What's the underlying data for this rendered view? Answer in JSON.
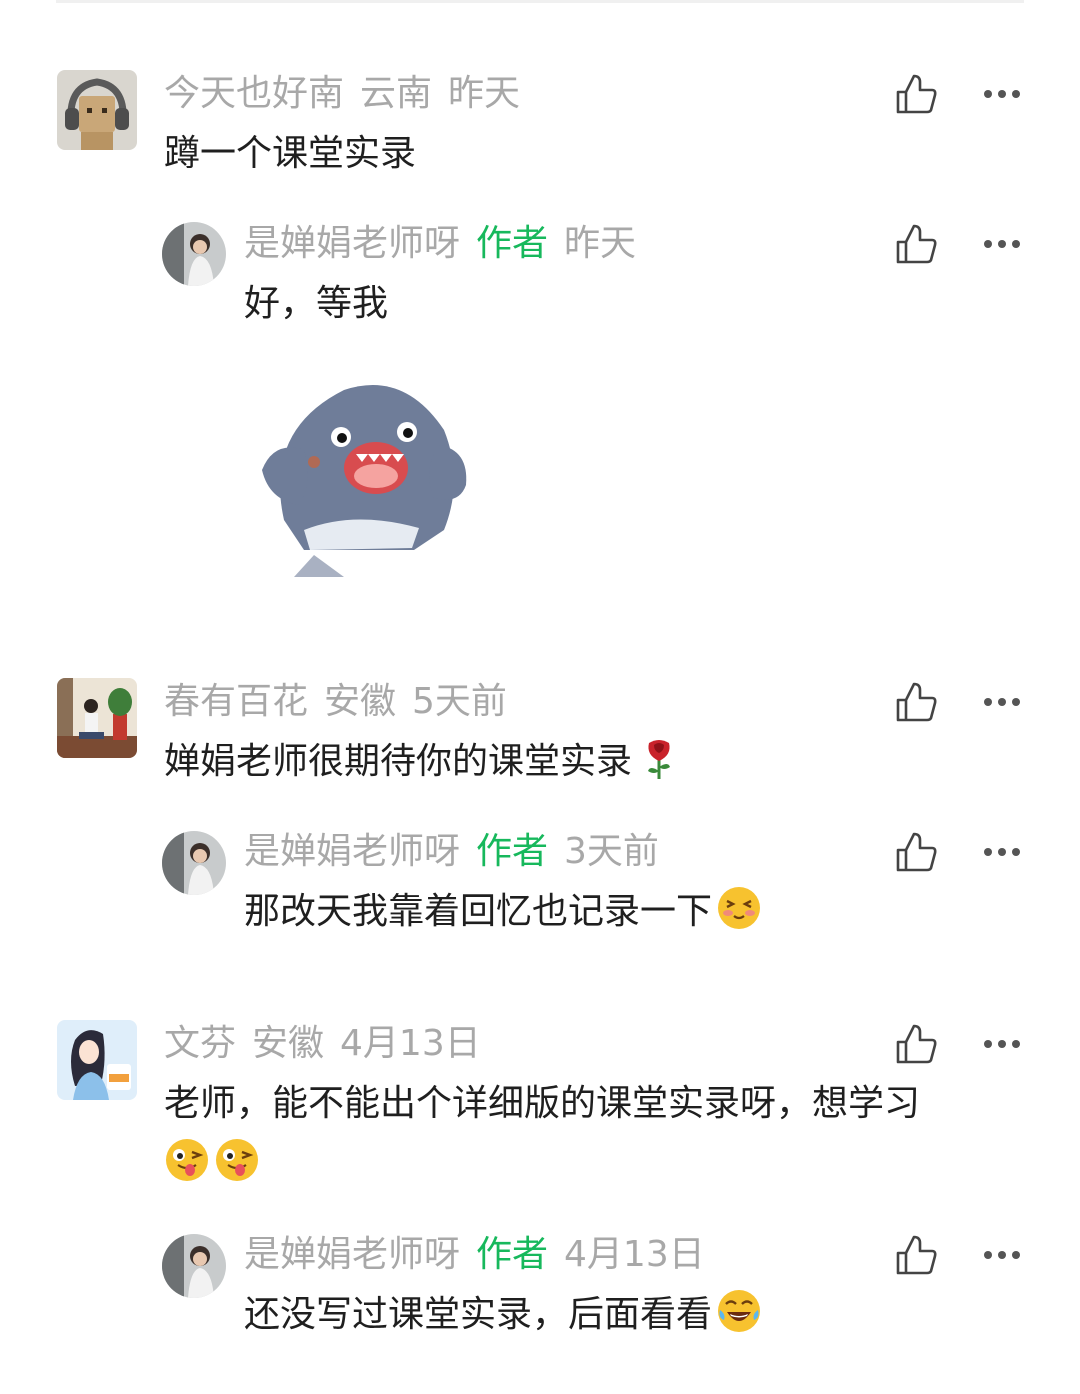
{
  "comments": [
    {
      "name": "今天也好南",
      "location": "云南",
      "time": "昨天",
      "text": "蹲一个课堂实录",
      "reply": {
        "name": "是婵娟老师呀",
        "tag": "作者",
        "time": "昨天",
        "text": "好，等我"
      }
    },
    {
      "name": "春有百花",
      "location": "安徽",
      "time": "5天前",
      "text": "婵娟老师很期待你的课堂实录",
      "text_emoji": "rose-icon",
      "reply": {
        "name": "是婵娟老师呀",
        "tag": "作者",
        "time": "3天前",
        "text": "那改天我靠着回忆也记录一下",
        "emoji": "shy-face-icon"
      }
    },
    {
      "name": "文芬",
      "location": "安徽",
      "time": "4月13日",
      "text": "老师，能不能出个详细版的课堂实录呀，想学习",
      "text_emoji": "wink-tongue-face-icon",
      "reply": {
        "name": "是婵娟老师呀",
        "tag": "作者",
        "time": "4月13日",
        "text": "还没写过课堂实录，后面看看",
        "emoji": "laughing-tears-face-icon"
      }
    }
  ],
  "icons": {
    "like": "thumbs-up-icon",
    "more": "more-dots-icon"
  },
  "colors": {
    "author_tag": "#17b85c",
    "meta": "#a8a8a8",
    "text": "#1f1f1f"
  }
}
